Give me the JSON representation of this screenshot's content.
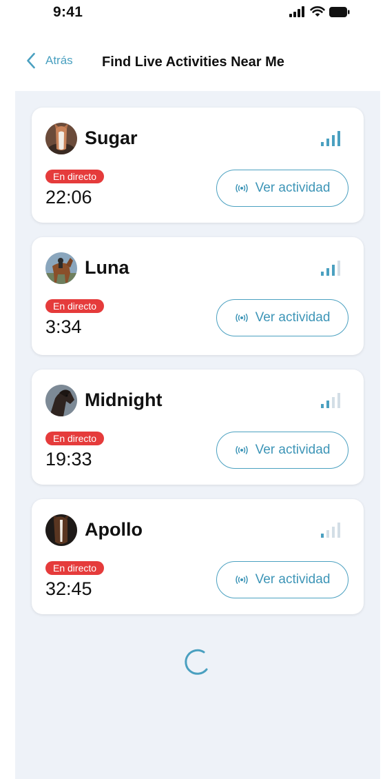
{
  "status_bar": {
    "time": "9:41"
  },
  "nav": {
    "back_label": "Atrás",
    "title": "Find Live Activities Near Me"
  },
  "activities": [
    {
      "name": "Sugar",
      "badge": "En directo",
      "elapsed": "22:06",
      "action_label": "Ver actividad",
      "signal_level": 4,
      "avatar": "horse-avatar-chestnut-white"
    },
    {
      "name": "Luna",
      "badge": "En directo",
      "elapsed": "3:34",
      "action_label": "Ver actividad",
      "signal_level": 3,
      "avatar": "horse-avatar-bay-rider"
    },
    {
      "name": "Midnight",
      "badge": "En directo",
      "elapsed": "19:33",
      "action_label": "Ver actividad",
      "signal_level": 2,
      "avatar": "horse-avatar-dark"
    },
    {
      "name": "Apollo",
      "badge": "En directo",
      "elapsed": "32:45",
      "action_label": "Ver actividad",
      "signal_level": 1,
      "avatar": "horse-avatar-brown-blaze"
    }
  ],
  "colors": {
    "accent": "#4aa0c0",
    "live_badge": "#e53b3b",
    "content_background": "#eef2f8",
    "signal_inactive": "#d3dee6"
  },
  "icons": {
    "back": "chevron-left-icon",
    "cellular": "cellular-signal-icon",
    "wifi": "wifi-icon",
    "battery": "battery-icon",
    "broadcast": "broadcast-icon",
    "loading": "loading-spinner-icon"
  }
}
